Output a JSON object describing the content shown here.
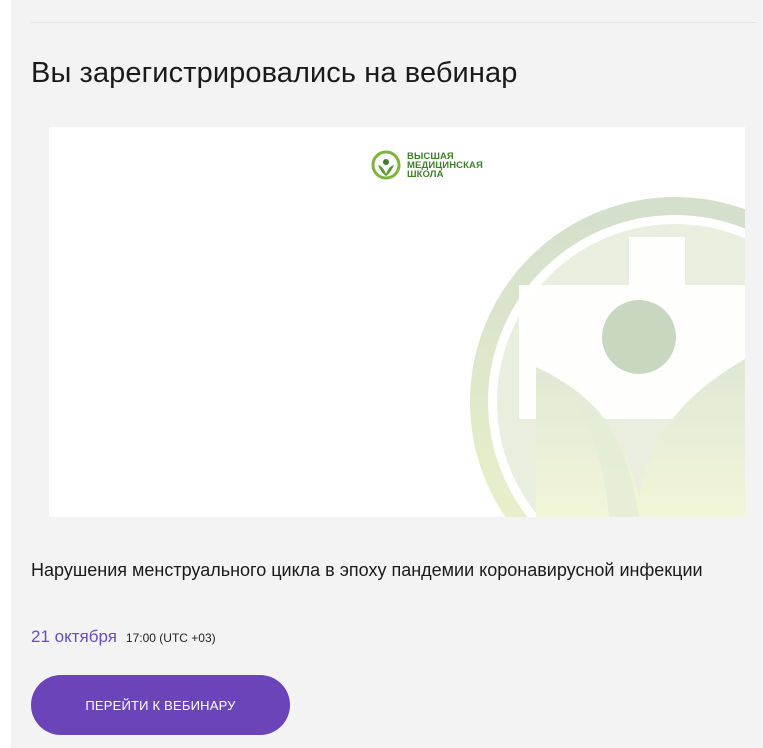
{
  "page": {
    "title": "Вы зарегистрировались на вебинар"
  },
  "banner": {
    "logo_icon": "medical-school-logo-icon",
    "logo_lines": [
      "ВЫСШАЯ",
      "МЕДИЦИНСКАЯ",
      "ШКОЛА"
    ]
  },
  "webinar": {
    "name": "Нарушения менструального цикла в эпоху пандемии коронавирусной инфекции",
    "date": "21 октября",
    "time": "17:00 (UTC +03)"
  },
  "actions": {
    "go_label": "ПЕРЕЙТИ К ВЕБИНАРУ"
  },
  "colors": {
    "accent": "#6a44b8",
    "date": "#6a4bc2",
    "logo_green": "#3f7f2a",
    "card_bg": "#f3f3f3"
  }
}
